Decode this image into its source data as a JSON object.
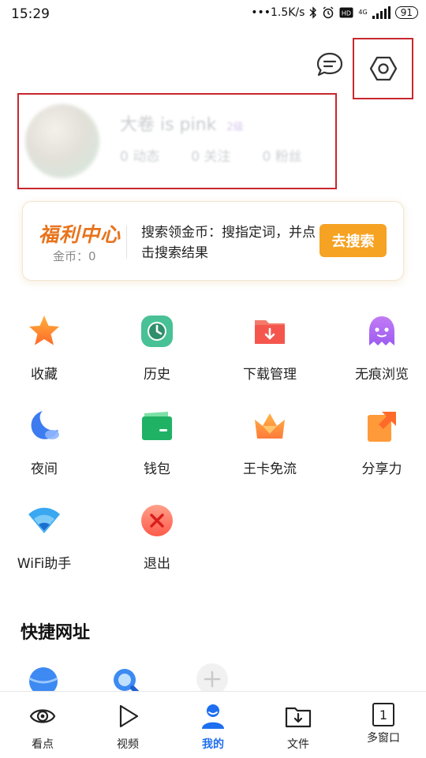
{
  "status_bar": {
    "time": "15:29",
    "network_speed": "•••1.5K/s",
    "network_type": "4G",
    "battery": "91",
    "icons": [
      "bluetooth-icon",
      "alarm-icon",
      "hd-icon",
      "signal-icon"
    ]
  },
  "header": {
    "icons": [
      "message-icon",
      "settings-icon"
    ]
  },
  "profile": {
    "name": "大卷 is pink",
    "level": "2级",
    "stats": [
      {
        "label": "0 动态"
      },
      {
        "label": "0 关注"
      },
      {
        "label": "0 粉丝"
      }
    ]
  },
  "welfare": {
    "title": "福利中心",
    "coins": "金币：0",
    "description": "搜索领金币：搜指定词，并点击搜索结果",
    "button": "去搜索",
    "accent": "#f6a223"
  },
  "grid": [
    {
      "label": "收藏",
      "icon": "star-icon"
    },
    {
      "label": "历史",
      "icon": "clock-icon"
    },
    {
      "label": "下载管理",
      "icon": "download-folder-icon"
    },
    {
      "label": "无痕浏览",
      "icon": "ghost-icon"
    },
    {
      "label": "夜间",
      "icon": "moon-icon"
    },
    {
      "label": "钱包",
      "icon": "wallet-icon"
    },
    {
      "label": "王卡免流",
      "icon": "crown-icon"
    },
    {
      "label": "分享力",
      "icon": "share-icon"
    },
    {
      "label": "WiFi助手",
      "icon": "wifi-icon"
    },
    {
      "label": "退出",
      "icon": "exit-icon"
    }
  ],
  "quick_links": {
    "title": "快捷网址",
    "icons": [
      "planet-icon",
      "search-icon",
      "add-icon"
    ]
  },
  "bottom_nav": [
    {
      "label": "看点",
      "icon": "eye-icon",
      "active": false
    },
    {
      "label": "视频",
      "icon": "play-icon",
      "active": false
    },
    {
      "label": "我的",
      "icon": "person-icon",
      "active": true
    },
    {
      "label": "文件",
      "icon": "folder-download-icon",
      "active": false
    },
    {
      "label": "多窗口",
      "icon": "window-count-icon",
      "active": false,
      "count": "1"
    }
  ],
  "colors": {
    "active": "#1e6ef0",
    "highlight_box": "#c8272e"
  }
}
